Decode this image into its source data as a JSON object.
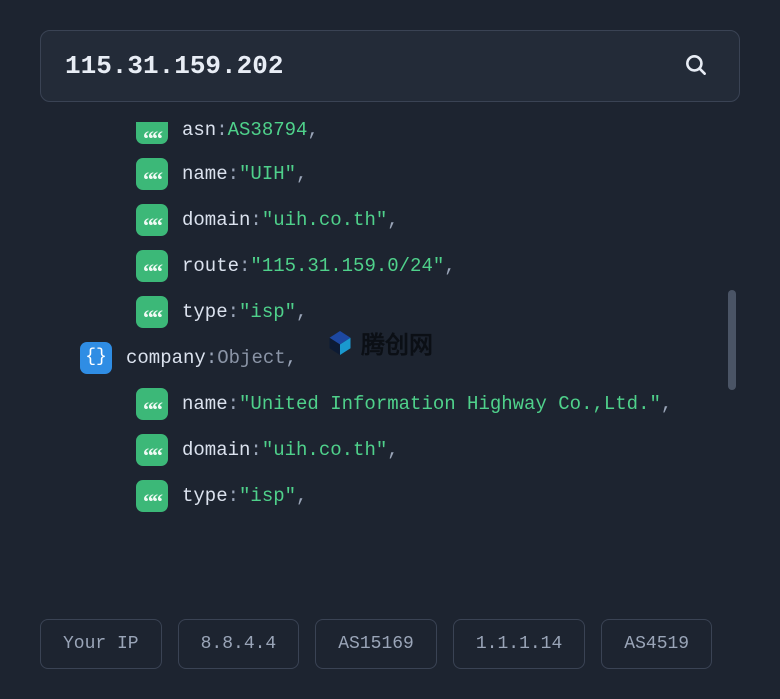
{
  "search": {
    "value": "115.31.159.202"
  },
  "rows": [
    {
      "indent": 2,
      "badge": "str",
      "key": "asn",
      "valType": "id",
      "val": "AS38794",
      "comma": true,
      "cutTop": true
    },
    {
      "indent": 2,
      "badge": "str",
      "key": "name",
      "valType": "str",
      "val": "\"UIH\"",
      "comma": true
    },
    {
      "indent": 2,
      "badge": "str",
      "key": "domain",
      "valType": "str",
      "val": "\"uih.co.th\"",
      "comma": true
    },
    {
      "indent": 2,
      "badge": "str",
      "key": "route",
      "valType": "str",
      "val": "\"115.31.159.0/24\"",
      "comma": true
    },
    {
      "indent": 2,
      "badge": "str",
      "key": "type",
      "valType": "str",
      "val": "\"isp\"",
      "comma": true
    },
    {
      "indent": 1,
      "badge": "obj",
      "key": "company",
      "valType": "obj",
      "val": "Object",
      "comma": true
    },
    {
      "indent": 2,
      "badge": "str",
      "key": "name",
      "valType": "str",
      "val": "\"United Information Highway Co.,Ltd.\"",
      "comma": true
    },
    {
      "indent": 2,
      "badge": "str",
      "key": "domain",
      "valType": "str",
      "val": "\"uih.co.th\"",
      "comma": true
    },
    {
      "indent": 2,
      "badge": "str",
      "key": "type",
      "valType": "str",
      "val": "\"isp\"",
      "comma": true
    }
  ],
  "watermark": {
    "text": "腾创网"
  },
  "chips": [
    "Your IP",
    "8.8.4.4",
    "AS15169",
    "1.1.1.14",
    "AS4519"
  ]
}
